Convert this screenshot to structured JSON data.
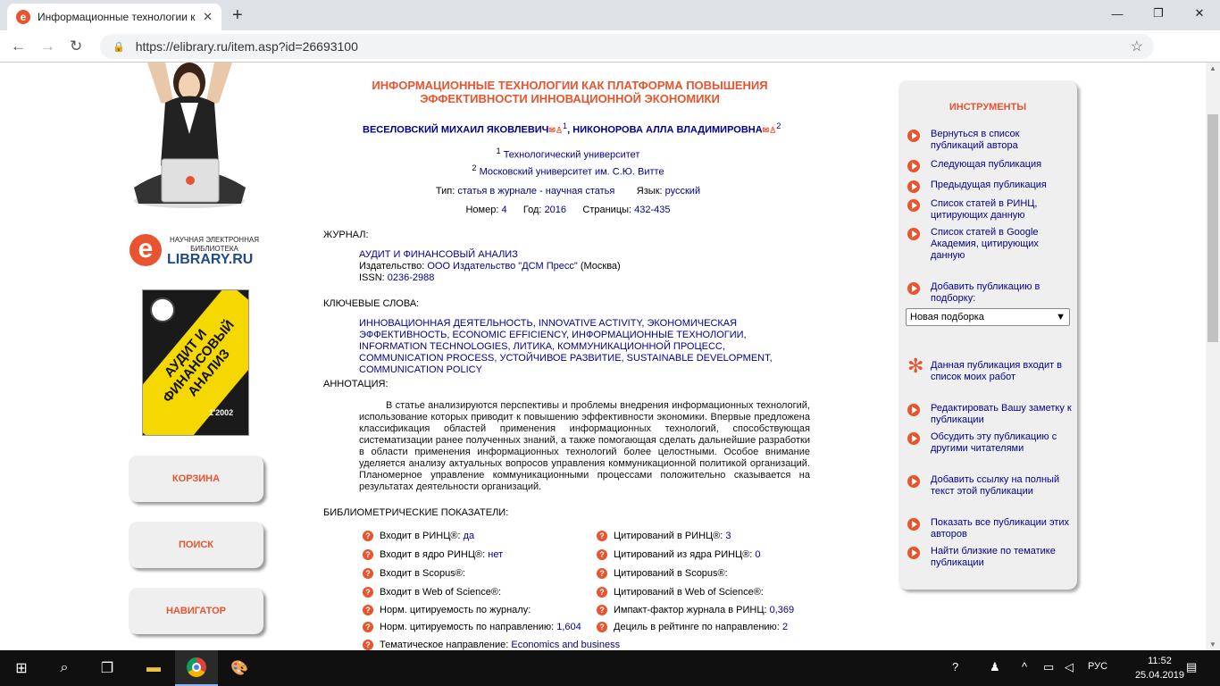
{
  "browser": {
    "tab_title": "Информационные технологии к",
    "url": "https://elibrary.ru/item.asp?id=26693100"
  },
  "logo": {
    "line1": "НАУЧНАЯ ЭЛЕКТРОННАЯ",
    "line2": "БИБЛИОТЕКА",
    "brand": "LIBRARY.RU",
    "e": "e"
  },
  "cover": {
    "title": "АУДИТ И ФИНАНСОВЫЙ АНАЛИЗ",
    "issue": "1'2002"
  },
  "left_buttons": [
    "КОРЗИНА",
    "ПОИСК",
    "НАВИГАТОР"
  ],
  "article": {
    "title": "ИНФОРМАЦИОННЫЕ ТЕХНОЛОГИИ КАК ПЛАТФОРМА ПОВЫШЕНИЯ ЭФФЕКТИВНОСТИ ИННОВАЦИОННОЙ ЭКОНОМИКИ",
    "author1": "ВЕСЕЛОВСКИЙ МИХАИЛ ЯКОВЛЕВИЧ",
    "author1_sup": "1",
    "author2": "НИКОНОРОВА АЛЛА ВЛАДИМИРОВНА",
    "author2_sup": "2",
    "aff1_sup": "1",
    "aff1": "Технологический университет",
    "aff2_sup": "2",
    "aff2": "Московский университет им. С.Ю. Витте",
    "type_label": "Тип:",
    "type_value": "статья в журнале - научная статья",
    "lang_label": "Язык:",
    "lang_value": "русский",
    "num_label": "Номер:",
    "num_value": "4",
    "year_label": "Год:",
    "year_value": "2016",
    "pages_label": "Страницы:",
    "pages_value": "432-435"
  },
  "journal": {
    "label": "ЖУРНАЛ:",
    "name": "АУДИТ И ФИНАНСОВЫЙ АНАЛИЗ",
    "publisher_label": "Издательство:",
    "publisher": "ООО Издательство \"ДСМ Пресс\"",
    "city": "(Москва)",
    "issn_label": "ISSN:",
    "issn": "0236-2988"
  },
  "keywords": {
    "label": "КЛЮЧЕВЫЕ СЛОВА:",
    "text": "ИННОВАЦИОННАЯ ДЕЯТЕЛЬНОСТЬ, INNOVATIVE ACTIVITY, ЭКОНОМИЧЕСКАЯ ЭФФЕКТИВНОСТЬ, ECONOMIC EFFICIENCY, ИНФОРМАЦИОННЫЕ ТЕХНОЛОГИИ, INFORMATION TECHNOLOGIES, ЛИТИКА, КОММУНИКАЦИОННОЙ ПРОЦЕСС, COMMUNICATION PROCESS, УСТОЙЧИВОЕ РАЗВИТИЕ, SUSTAINABLE DEVELOPMENT, COMMUNICATION POLICY"
  },
  "abstract": {
    "label": "АННОТАЦИЯ:",
    "text": "В статье анализируются перспективы и проблемы внедрения информационных технологий, использование которых приводит к повышению эффективности экономики. Впервые предложена классификация областей применения информационных технологий, способствующая систематизации ранее полученных знаний, а также помогающая сделать дальнейшие разработки в области применения информационных технологий более целостными. Особое внимание уделяется анализу актуальных вопросов управления коммуникационной политикой организаций. Планомерное управление коммуникационными процессами положительно сказывается на результатах деятельности организаций."
  },
  "biblio": {
    "label": "БИБЛИОМЕТРИЧЕСКИЕ ПОКАЗАТЕЛИ:",
    "left": [
      {
        "label": "Входит в РИНЦ®:",
        "value": "да"
      },
      {
        "label": "Входит в ядро РИНЦ®:",
        "value": "нет"
      },
      {
        "label": "Входит в Scopus®:",
        "value": ""
      },
      {
        "label": "Входит в Web of Science®:",
        "value": ""
      },
      {
        "label": "Норм. цитируемость по журналу:",
        "value": ""
      },
      {
        "label": "Норм. цитируемость по направлению:",
        "value": "1,604"
      },
      {
        "label": "Тематическое направление:",
        "value": "Economics and business"
      }
    ],
    "right": [
      {
        "label": "Цитирований в РИНЦ®:",
        "value": "3"
      },
      {
        "label": "Цитирований из ядра РИНЦ®:",
        "value": "0"
      },
      {
        "label": "Цитирований в Scopus®:",
        "value": ""
      },
      {
        "label": "Цитирований в Web of Science®:",
        "value": ""
      },
      {
        "label": "Импакт-фактор журнала в РИНЦ:",
        "value": "0,369"
      },
      {
        "label": "Дециль в рейтинге по направлению:",
        "value": "2"
      }
    ]
  },
  "tools": {
    "title": "ИНСТРУМЕНТЫ",
    "items": [
      "Вернуться в список публикаций автора",
      "Следующая публикация",
      "Предыдущая публикация",
      "Список статей в РИНЦ, цитирующих данную",
      "Список статей в Google Академия, цитирующих данную",
      "Добавить публикацию в подборку:",
      "Данная публикация входит в список моих работ",
      "Редактировать Вашу заметку к публикации",
      "Обсудить эту публикацию с другими читателями",
      "Добавить ссылку на полный текст этой публикации",
      "Показать все публикации этих авторов",
      "Найти близкие по тематике публикации"
    ],
    "select_value": "Новая подборка"
  },
  "taskbar": {
    "lang": "РУС",
    "time": "11:52",
    "date": "25.04.2019"
  }
}
